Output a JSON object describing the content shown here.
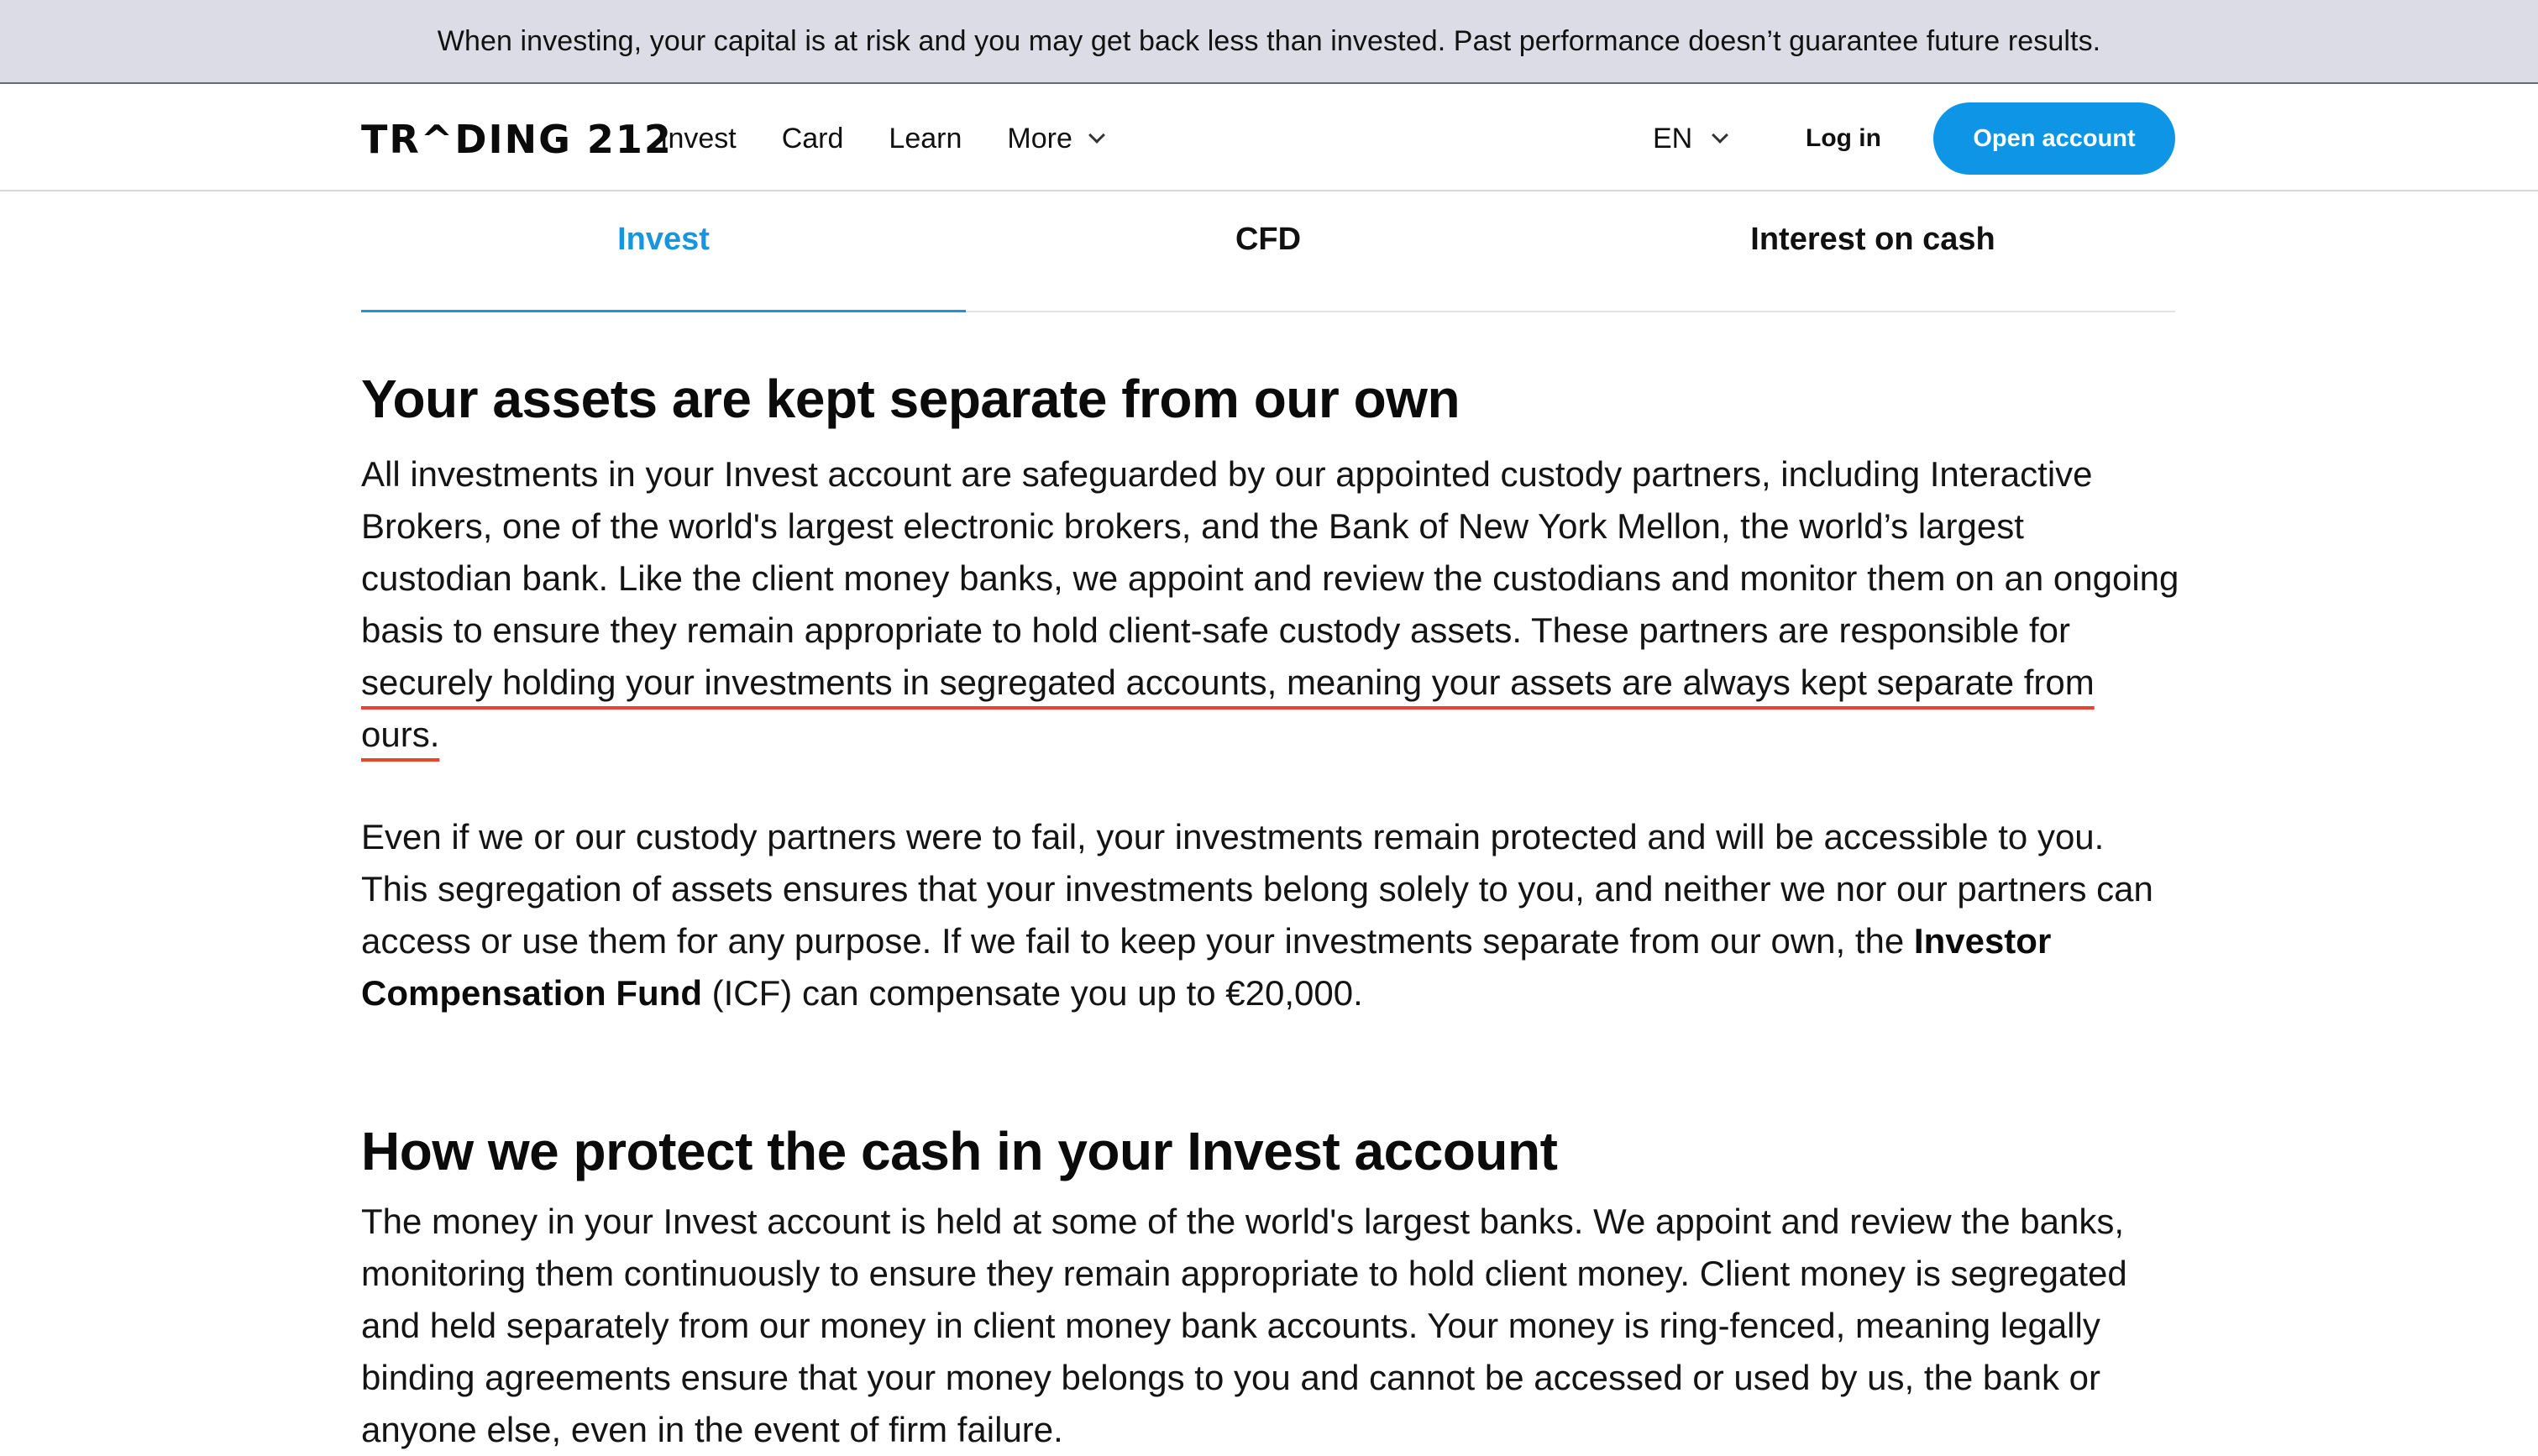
{
  "banner": {
    "text": "When investing, your capital is at risk and you may get back less than invested. Past performance doesn’t guarantee future results."
  },
  "header": {
    "logo": "TR^DING 212",
    "nav": [
      {
        "label": "Invest"
      },
      {
        "label": "Card"
      },
      {
        "label": "Learn"
      },
      {
        "label": "More"
      }
    ],
    "language": "EN",
    "login_label": "Log in",
    "open_account_label": "Open account",
    "accent_color": "#0f95e6"
  },
  "tabs": [
    {
      "label": "Invest",
      "active": true
    },
    {
      "label": "CFD",
      "active": false
    },
    {
      "label": "Interest on cash",
      "active": false
    }
  ],
  "section1": {
    "title": "Your assets are kept separate from our own",
    "p1_a": "All investments in your Invest account are safeguarded by our appointed custody partners, including Interactive Brokers, one of the world's largest electronic brokers, and the Bank of New York Mellon, the world’s largest custodian bank. Like the client money banks, we appoint and review the custodians and monitor them on an ongoing basis to ensure they remain appropriate to hold client-safe custody assets. These partners are responsible for ",
    "p1_highlight": "securely holding your investments in segregated accounts, meaning your assets are always kept separate from ours.",
    "p2_a": "Even if we or our custody partners were to fail, your investments remain protected and will be accessible to you. This segregation of assets ensures that your investments belong solely to you, and neither we nor our partners can access or use them for any purpose. If we fail to keep your investments separate from our own, the ",
    "p2_bold": "Investor Compensation Fund",
    "p2_b": " (ICF) can compensate you up to €20,000."
  },
  "section2": {
    "title": "How we protect the cash in your Invest account",
    "p1": "The money in your Invest account is held at some of the world's largest banks. We appoint and review the banks, monitoring them continuously to ensure they remain appropriate to hold client money. Client money is segregated and held separately from our money in client money bank accounts. Your money is ring-fenced, meaning legally binding agreements ensure that your money belongs to you and cannot be accessed or used by us, the bank or anyone else, even in the event of firm failure."
  }
}
